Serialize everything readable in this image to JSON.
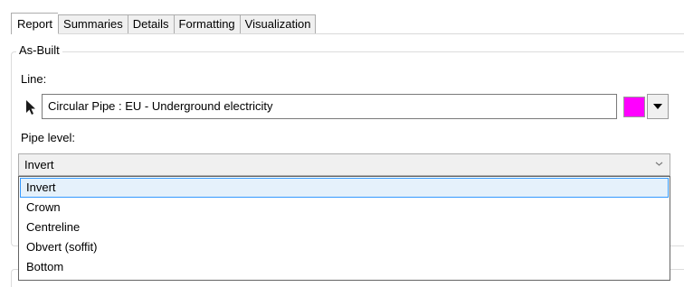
{
  "tabs": [
    {
      "label": "Report",
      "active": true
    },
    {
      "label": "Summaries",
      "active": false
    },
    {
      "label": "Details",
      "active": false
    },
    {
      "label": "Formatting",
      "active": false
    },
    {
      "label": "Visualization",
      "active": false
    }
  ],
  "as_built": {
    "title": "As-Built",
    "line_label": "Line:",
    "line_value": "Circular Pipe : EU - Underground electricity",
    "line_color": "#ff00ff",
    "pick_icon": "arrow-pointer-icon",
    "pipe_level_label": "Pipe level:",
    "pipe_level_value": "Invert",
    "pipe_level_options": [
      "Invert",
      "Crown",
      "Centreline",
      "Obvert (soffit)",
      "Bottom"
    ],
    "selected_option": "Invert"
  },
  "colors": {
    "selection_fill": "#e5f1fb",
    "selection_border": "#3399ff",
    "swatch": "#ff00ff"
  }
}
